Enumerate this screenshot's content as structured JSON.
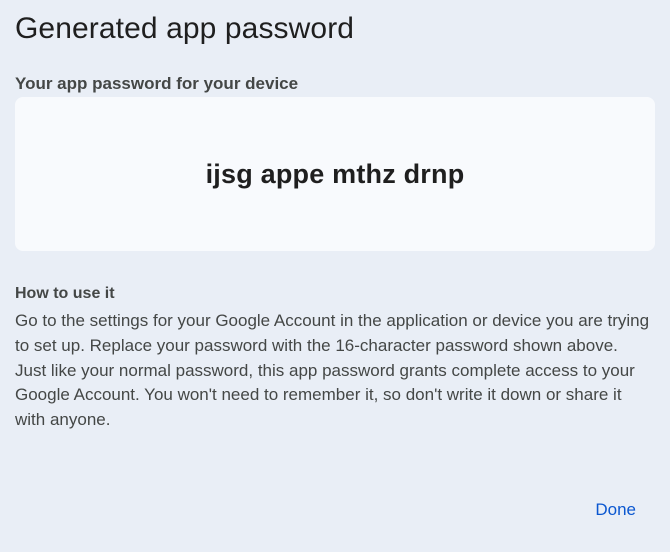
{
  "dialog": {
    "title": "Generated app password"
  },
  "password_section": {
    "label": "Your app password for your device",
    "value": "ijsg appe mthz drnp"
  },
  "instructions": {
    "heading": "How to use it",
    "paragraphs": [
      "Go to the settings for your Google Account in the application or device you are trying to set up. Replace your password with the 16-character password shown above.",
      "Just like your normal password, this app password grants complete access to your Google Account. You won't need to remember it, so don't write it down or share it with anyone."
    ]
  },
  "actions": {
    "done_label": "Done"
  },
  "colors": {
    "background": "#e9eef6",
    "password_box": "#f8fafd",
    "accent": "#0b57d0",
    "text_primary": "#1f1f1f",
    "text_secondary": "#444746"
  }
}
